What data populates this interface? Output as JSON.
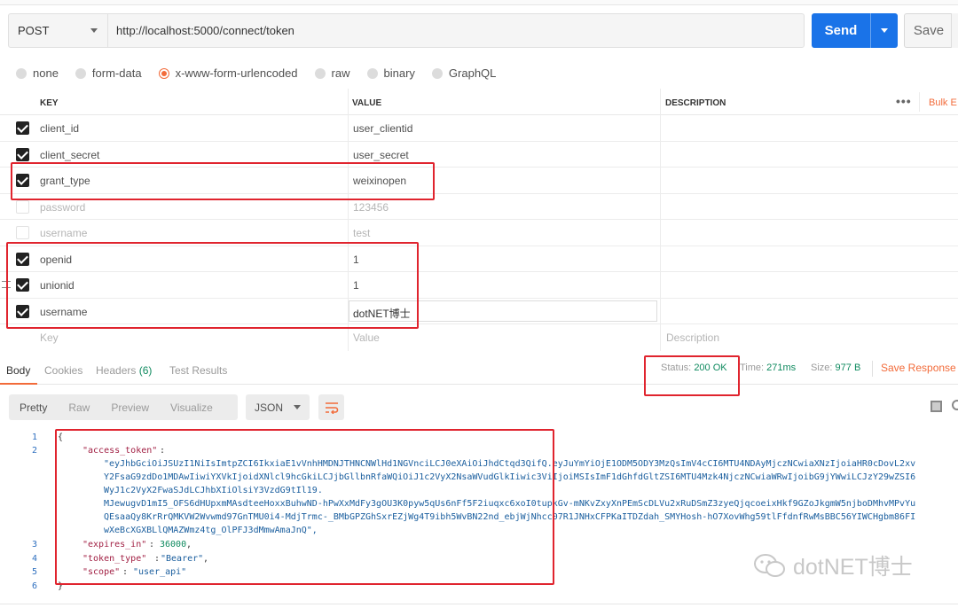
{
  "request": {
    "method": "POST",
    "url": "http://localhost:5000/connect/token",
    "send_label": "Send",
    "save_label": "Save"
  },
  "body_types": [
    {
      "label": "none",
      "selected": false
    },
    {
      "label": "form-data",
      "selected": false
    },
    {
      "label": "x-www-form-urlencoded",
      "selected": true
    },
    {
      "label": "raw",
      "selected": false
    },
    {
      "label": "binary",
      "selected": false
    },
    {
      "label": "GraphQL",
      "selected": false
    }
  ],
  "table": {
    "headers": {
      "key": "KEY",
      "value": "VALUE",
      "description": "DESCRIPTION",
      "bulk_edit": "Bulk E"
    },
    "rows": [
      {
        "key": "client_id",
        "value": "user_clientid",
        "checked": true
      },
      {
        "key": "client_secret",
        "value": "user_secret",
        "checked": true
      },
      {
        "key": "grant_type",
        "value": "weixinopen",
        "checked": true
      },
      {
        "key": "password",
        "value": "123456",
        "checked": false
      },
      {
        "key": "username",
        "value": "test",
        "checked": false
      },
      {
        "key": "openid",
        "value": "1",
        "checked": true
      },
      {
        "key": "unionid",
        "value": "1",
        "checked": true
      },
      {
        "key": "username",
        "value": "dotNET博士",
        "checked": true
      }
    ],
    "placeholders": {
      "key": "Key",
      "value": "Value",
      "description": "Description"
    }
  },
  "response_tabs": {
    "body": "Body",
    "cookies": "Cookies",
    "headers_label": "Headers",
    "headers_count": "(6)",
    "test_results": "Test Results"
  },
  "status": {
    "status_label": "Status:",
    "status_value": "200 OK",
    "time_label": "Time:",
    "time_value": "271ms",
    "size_label": "Size:",
    "size_value": "977 B",
    "save_response": "Save Response"
  },
  "format_bar": {
    "pretty": "Pretty",
    "raw": "Raw",
    "preview": "Preview",
    "visualize": "Visualize",
    "format": "JSON"
  },
  "code": {
    "line_numbers": [
      "1",
      "2",
      "3",
      "4",
      "5",
      "6"
    ],
    "open_brace": "{",
    "close_brace": "}",
    "k_access_token": "\"access_token\"",
    "token_lines": [
      "\"eyJhbGciOiJSUzI1NiIsImtpZCI6IkxiaE1vVnhHMDNJTHNCNWlHd1NGVnciLCJ0eXAiOiJhdCtqd3QifQ.eyJuYmYiOjE1ODM5ODY3MzQsImV4cCI6MTU4NDAyMjczNCwiaXNzIjoiaHR0cDovL2xv",
      "Y2FsaG9zdDo1MDAwIiwiYXVkIjoidXNlcl9hcGkiLCJjbGllbnRfaWQiOiJ1c2VyX2NsaWVudGlkIiwic3ViIjoiMSIsImF1dGhfdGltZSI6MTU4Mzk4NjczNCwiaWRwIjoibG9jYWwiLCJzY29wZSI6",
      "WyJ1c2VyX2FwaSJdLCJhbXIiOlsiY3VzdG9tIl19.",
      "MJewugvD1mI5_OFS6dHUpxmMAsdteeHoxxBuhwND-hPwXxMdFy3gOU3K0pyw5qUs6nFf5F2iuqxc6xoI0tupkGv-mNKvZxyXnPEmScDLVu2xRuDSmZ3zyeQjqcoeixHkf9GZoJkgmW5njboDMhvMPvYu",
      "QEsaaQy8KrRrQMKVW2Wvwmd97GnTMU0i4-MdjTrmc-_BMbGPZGhSxrEZjWg4T9ibh5WvBN22nd_ebjWjNhcc07R1JNHxCFPKaITDZdah_SMYHosh-hO7XovWhg59tlFfdnfRwMsBBC56YIWCHgbm86FI",
      "wXeBcXGXBLlQMAZWmz4tg_OlPFJ3dMmwAmaJnQ\","
    ],
    "k_expires_in": "\"expires_in\"",
    "v_expires_in": "36000",
    "k_token_type": "\"token_type\"",
    "v_token_type": "\"Bearer\"",
    "k_scope": "\"scope\"",
    "v_scope": "\"user_api\""
  },
  "watermark": "dotNET博士"
}
